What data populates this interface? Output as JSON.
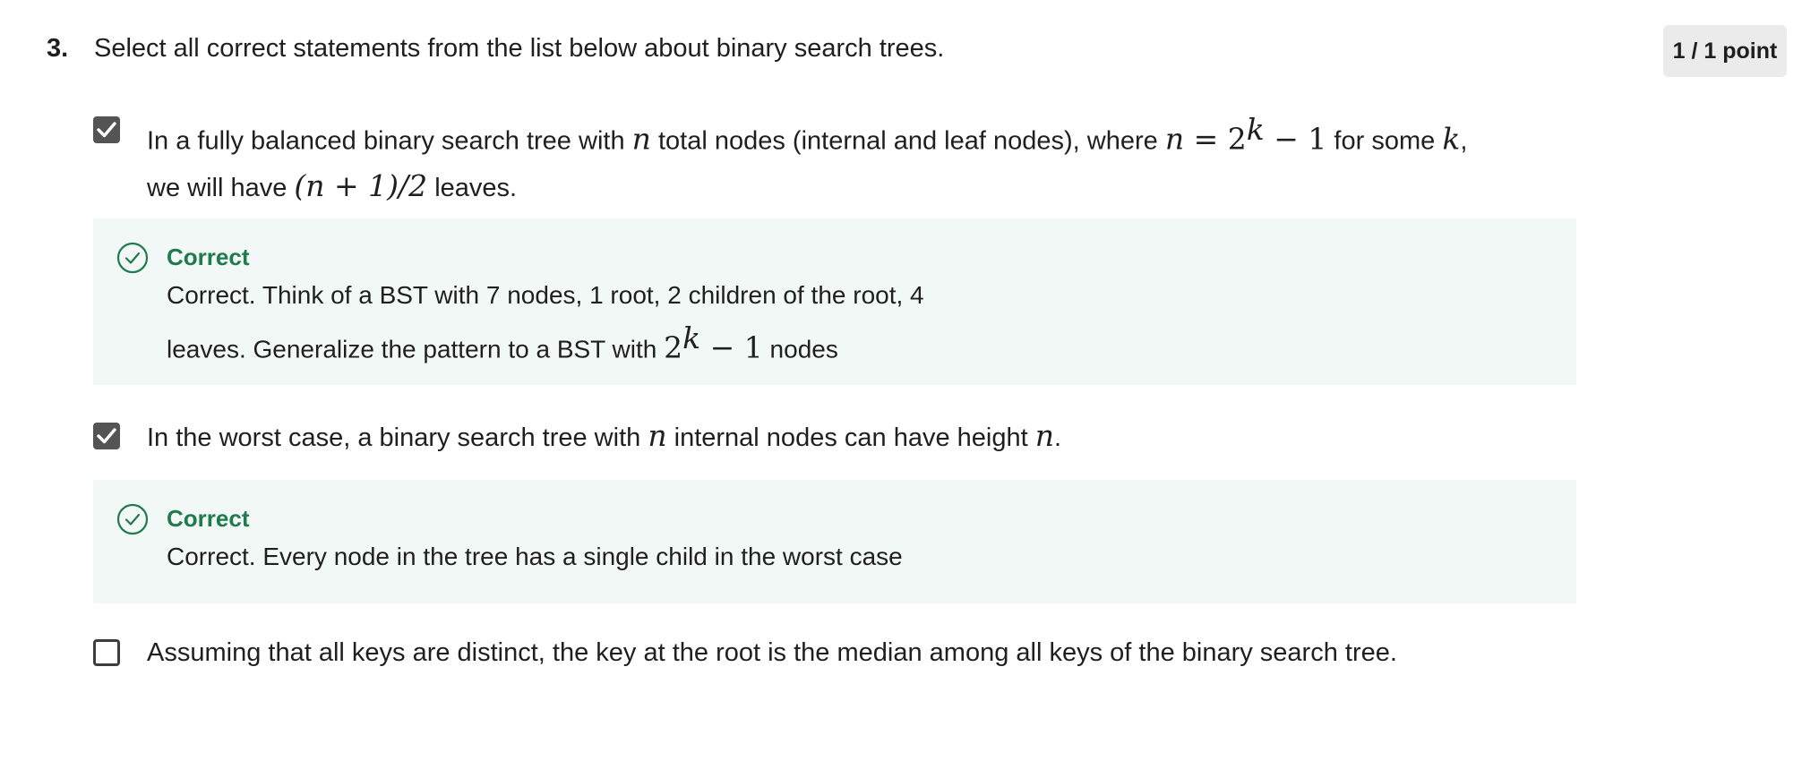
{
  "question": {
    "number": "3.",
    "text": "Select all correct statements from the list below about binary search trees.",
    "points": "1 / 1 point"
  },
  "options": [
    {
      "checked": true,
      "line1_a": "In a fully balanced binary search tree with ",
      "n1": "n",
      "line1_b": " total nodes (internal and leaf nodes), where ",
      "eq_n": "n",
      "eq_mid": " = 2",
      "eq_k": "k",
      "eq_end": " − 1",
      "line1_c": " for some ",
      "k": "k",
      "line1_d": ",",
      "line2_a": "we will have ",
      "expr": "(n + 1)/2",
      "line2_b": " leaves.",
      "feedback": {
        "title": "Correct",
        "line1": "Correct. Think of a BST with 7 nodes, 1 root, 2 children of the root, 4",
        "line2_a": "leaves. Generalize the pattern to a BST with ",
        "math_base": "2",
        "math_k": "k",
        "math_end": " − 1",
        "line2_b": " nodes"
      }
    },
    {
      "checked": true,
      "text_a": "In the worst case, a binary search tree with ",
      "n1": "n",
      "text_b": " internal nodes can have height ",
      "n2": "n",
      "text_c": ".",
      "feedback": {
        "title": "Correct",
        "line1": "Correct. Every node in the tree has a single child in the worst case"
      }
    },
    {
      "checked": false,
      "text": "Assuming that all keys are distinct, the key at the root is the median among all keys of the binary search tree."
    }
  ],
  "icons": {
    "checkmark": "checkmark-icon",
    "correct": "check-circle-icon"
  },
  "colors": {
    "correct_green": "#1f7a4d",
    "feedback_bg": "#f2f8f5",
    "checkbox_fill": "#545454"
  }
}
